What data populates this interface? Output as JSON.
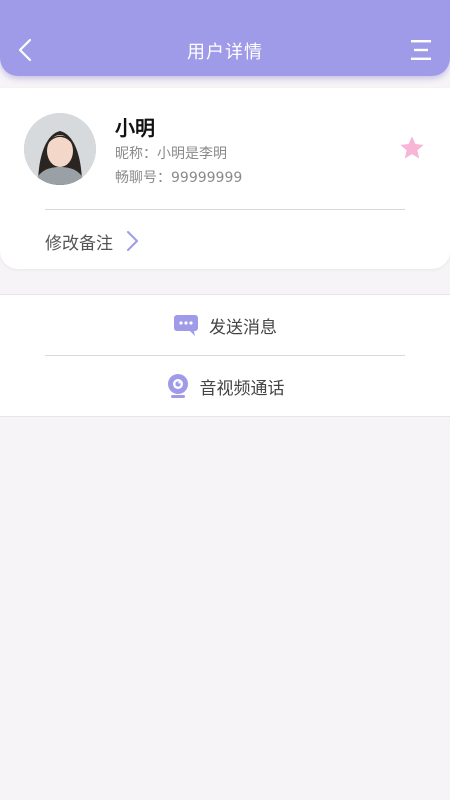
{
  "header": {
    "title": "用户详情",
    "back_icon": "chevron-left-icon",
    "menu_icon": "menu-icon"
  },
  "profile": {
    "name": "小明",
    "nickname": "昵称：小明是李明",
    "chat_id": "畅聊号：99999999",
    "favorite_icon": "star-icon",
    "avatar_icon": "avatar"
  },
  "remark": {
    "label": "修改备注",
    "arrow_icon": "chevron-right-icon"
  },
  "actions": [
    {
      "label": "发送消息",
      "icon": "chat-bubble-icon"
    },
    {
      "label": "音视频通话",
      "icon": "webcam-icon"
    }
  ],
  "colors": {
    "accent": "#9f9be9",
    "star": "#f7b6d6",
    "background": "#f6f4f6"
  }
}
